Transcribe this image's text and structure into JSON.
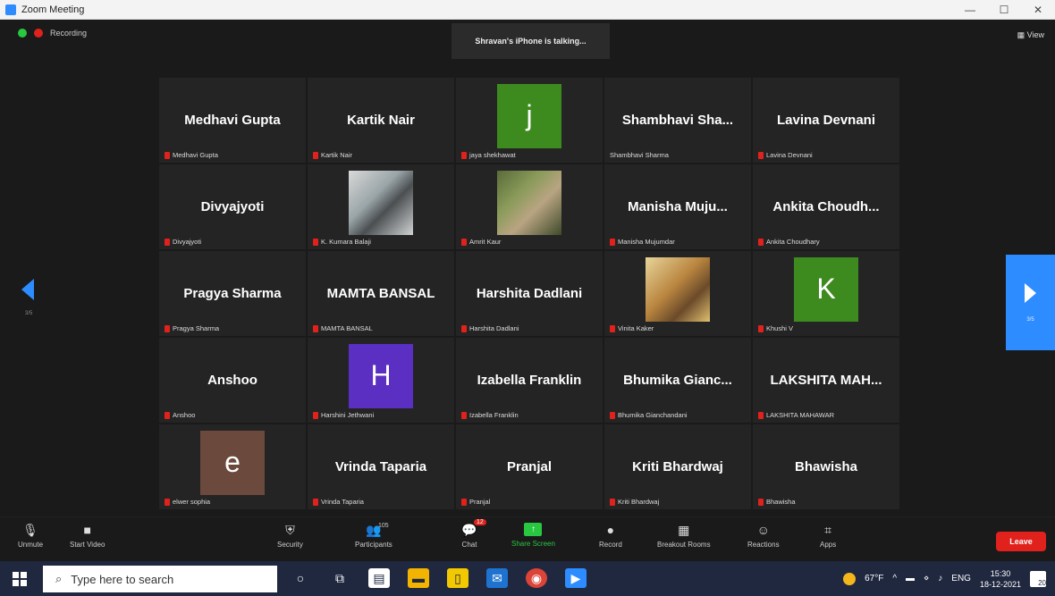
{
  "window": {
    "title": "Zoom Meeting",
    "controls": [
      "—",
      "☐",
      "✕"
    ]
  },
  "top": {
    "recording_label": "Recording",
    "talking": "Shravan's iPhone is talking...",
    "view_label": "View"
  },
  "grid": [
    {
      "big": "Medhavi Gupta",
      "small": "Medhavi Gupta",
      "muted": true
    },
    {
      "big": "Kartik Nair",
      "small": "Kartik Nair",
      "muted": true
    },
    {
      "avatar": "j",
      "avatar_color": "#3d8b1f",
      "small": "jaya shekhawat",
      "muted": true
    },
    {
      "big": "Shambhavi Sha...",
      "small": "Shambhavi Sharma",
      "muted": false
    },
    {
      "big": "Lavina Devnani",
      "small": "Lavina Devnani",
      "muted": true
    },
    {
      "big": "Divyajyoti",
      "small": "Divyajyoti",
      "muted": true
    },
    {
      "photo": "man",
      "small": "K. Kumara Balaji",
      "muted": true
    },
    {
      "photo": "plant",
      "small": "Amrit Kaur",
      "muted": true
    },
    {
      "big": "Manisha Muju...",
      "small": "Manisha Mujumdar",
      "muted": true
    },
    {
      "big": "Ankita Choudh...",
      "small": "Ankita Choudhary",
      "muted": true
    },
    {
      "big": "Pragya Sharma",
      "small": "Pragya Sharma",
      "muted": true
    },
    {
      "big": "MAMTA BANSAL",
      "small": "MAMTA BANSAL",
      "muted": true
    },
    {
      "big": "Harshita Dadlani",
      "small": "Harshita Dadlani",
      "muted": true
    },
    {
      "photo": "woman",
      "small": "Vinita Kaker",
      "muted": true
    },
    {
      "avatar": "K",
      "avatar_color": "#3d8b1f",
      "small": "Khushi V",
      "muted": true
    },
    {
      "big": "Anshoo",
      "small": "Anshoo",
      "muted": true
    },
    {
      "avatar": "H",
      "avatar_color": "#5a2fc2",
      "small": "Harshini Jethwani",
      "muted": true
    },
    {
      "big": "Izabella Franklin",
      "small": "Izabella Franklin",
      "muted": true
    },
    {
      "big": "Bhumika Gianc...",
      "small": "Bhumika Gianchandani",
      "muted": true
    },
    {
      "big": "LAKSHITA MAH...",
      "small": "LAKSHITA MAHAWAR",
      "muted": true
    },
    {
      "avatar": "e",
      "avatar_color": "#6b4a3d",
      "small": "elwer sophia",
      "muted": true
    },
    {
      "big": "Vrinda Taparia",
      "small": "Vrinda Taparia",
      "muted": true
    },
    {
      "big": "Pranjal",
      "small": "Pranjal",
      "muted": true
    },
    {
      "big": "Kriti Bhardwaj",
      "small": "Kriti Bhardwaj",
      "muted": true
    },
    {
      "big": "Bhawisha",
      "small": "Bhawisha",
      "muted": true
    }
  ],
  "nav": {
    "left_page": "3/5",
    "right_page": "3/5"
  },
  "toolbar": {
    "unmute": "Unmute",
    "start_video": "Start Video",
    "security": "Security",
    "participants": "Participants",
    "participants_count": "105",
    "chat": "Chat",
    "chat_badge": "12",
    "share": "Share Screen",
    "record": "Record",
    "breakout": "Breakout Rooms",
    "reactions": "Reactions",
    "apps": "Apps",
    "leave": "Leave"
  },
  "taskbar": {
    "search_placeholder": "Type here to search",
    "temperature": "67°F",
    "lang": "ENG",
    "time": "15:30",
    "date": "18-12-2021",
    "notif_count": "20"
  }
}
